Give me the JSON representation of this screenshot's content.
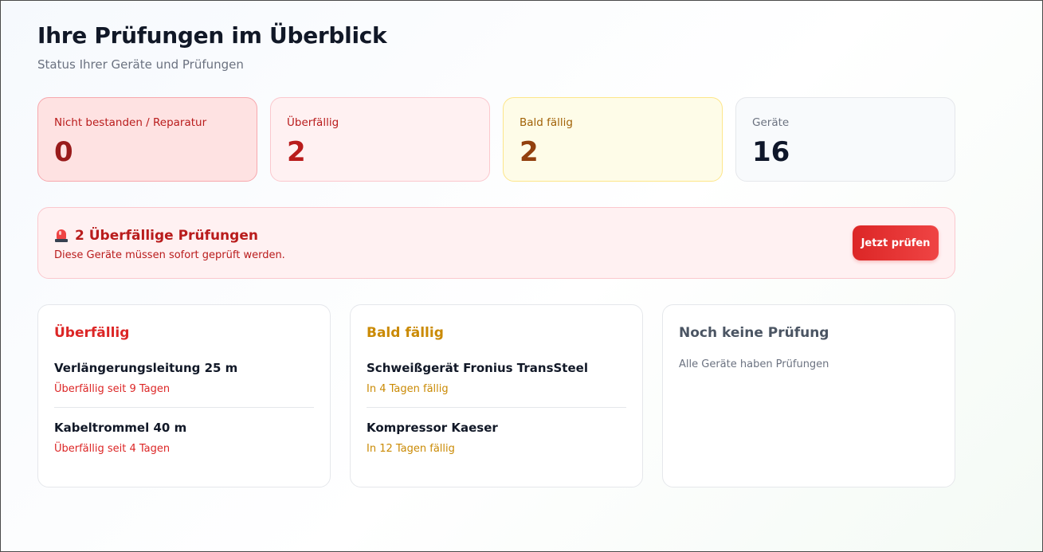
{
  "header": {
    "title": "Ihre Prüfungen im Überblick",
    "subtitle": "Status Ihrer Geräte und Prüfungen"
  },
  "stats": [
    {
      "label": "Nicht bestanden / Reparatur",
      "value": "0"
    },
    {
      "label": "Überfällig",
      "value": "2"
    },
    {
      "label": "Bald fällig",
      "value": "2"
    },
    {
      "label": "Geräte",
      "value": "16"
    }
  ],
  "alert": {
    "icon": "siren-icon",
    "title": "2 Überfällige Prüfungen",
    "description": "Diese Geräte müssen sofort geprüft werden.",
    "button_label": "Jetzt prüfen"
  },
  "columns": {
    "overdue": {
      "title": "Überfällig",
      "items": [
        {
          "name": "Verlängerungsleitung 25 m",
          "status": "Überfällig seit 9 Tagen"
        },
        {
          "name": "Kabeltrommel 40 m",
          "status": "Überfällig seit 4 Tagen"
        }
      ]
    },
    "due_soon": {
      "title": "Bald fällig",
      "items": [
        {
          "name": "Schweißgerät Fronius TransSteel",
          "status": "In 4 Tagen fällig"
        },
        {
          "name": "Kompressor Kaeser",
          "status": "In 12 Tagen fällig"
        }
      ]
    },
    "no_inspection": {
      "title": "Noch keine Prüfung",
      "empty_text": "Alle Geräte haben Prüfungen"
    }
  },
  "colors": {
    "danger": "#dc2626",
    "warning": "#ca8a04",
    "neutral": "#4b5563"
  }
}
